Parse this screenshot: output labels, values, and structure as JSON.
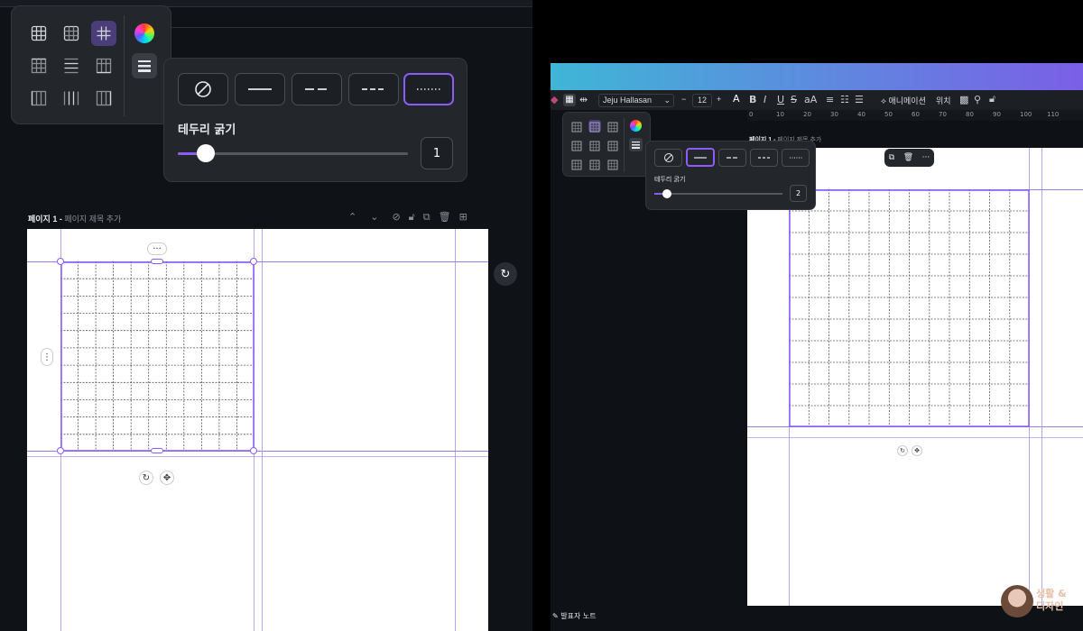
{
  "left": {
    "border_panel": {
      "title": "테두리 굵기",
      "thickness_value": "1",
      "slider_fraction": 0.12
    },
    "page_header": {
      "page_label": "페이지 1 -",
      "page_title_placeholder": "페이지 제목 추가"
    },
    "grid": {
      "rows": 11,
      "cols": 11
    }
  },
  "right": {
    "toolbar": {
      "font_name": "Jeju Hallasan",
      "font_size": "12",
      "animate_label": "애니메이션",
      "position_label": "위치"
    },
    "ruler_ticks": [
      "0",
      "10",
      "20",
      "30",
      "40",
      "50",
      "60",
      "70",
      "80",
      "90",
      "100",
      "110"
    ],
    "page_header": {
      "page_label": "페이지 1 -",
      "page_title_placeholder": "페이지 제목 추가"
    },
    "border_panel": {
      "title": "테두리 굵기",
      "thickness_value": "2",
      "slider_fraction": 0.1
    },
    "footer": {
      "notes_label": "발표자 노트"
    },
    "watermark": {
      "text_line1": "생활 &",
      "text_line2": "디자인"
    },
    "grid": {
      "rows": 11,
      "cols": 12
    }
  },
  "colors": {
    "accent": "#8b5cf6",
    "panel": "#23262b",
    "gradient_start": "#3fb6d6",
    "gradient_end": "#7b5fe6"
  }
}
